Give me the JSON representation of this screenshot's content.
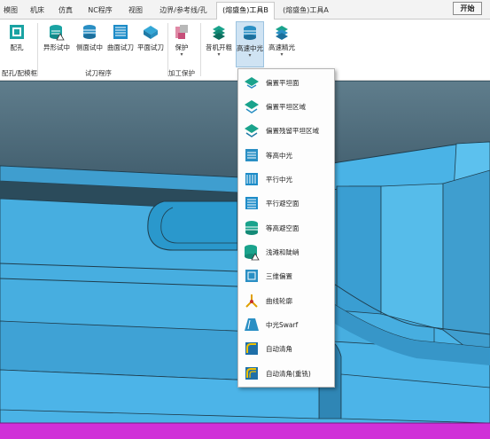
{
  "tabs": [
    "模图",
    "机床",
    "仿真",
    "NC程序",
    "视图",
    "边界/参考线/孔",
    "(熔盛鱼)工具B",
    "(熔盛鱼)工具A"
  ],
  "start_button": "开始",
  "ribbon": {
    "buttons": {
      "peikong": "配孔",
      "yixing": "异形试中",
      "cemian": "侧面试中",
      "qumian": "曲面试刀",
      "pingmian": "平面试刀",
      "baohu": "保护",
      "zhuji": "昔机开粗",
      "gaosu_zhongguang": "高速中光",
      "gaosu_jingguang": "高速精光"
    },
    "groups": {
      "peikong": "配孔/配模框",
      "shidao": "试刀程序",
      "jiagong": "加工保护"
    }
  },
  "menu": {
    "items": [
      "偏置平坦面",
      "偏置平坦区域",
      "偏置残留平坦区域",
      "等高中光",
      "平行中光",
      "平行避空面",
      "等高避空面",
      "浅滩和陡峭",
      "三维偏置",
      "曲线轮廓",
      "中光Swarf",
      "自动清角",
      "自动清角(重铣)"
    ]
  },
  "colors": {
    "cad_part": "#4ab3e6",
    "cad_wall": "#3f9ecf",
    "cad_edge": "#1f3d4d",
    "background": "#3d5a6a",
    "stock": "#d030d8"
  }
}
